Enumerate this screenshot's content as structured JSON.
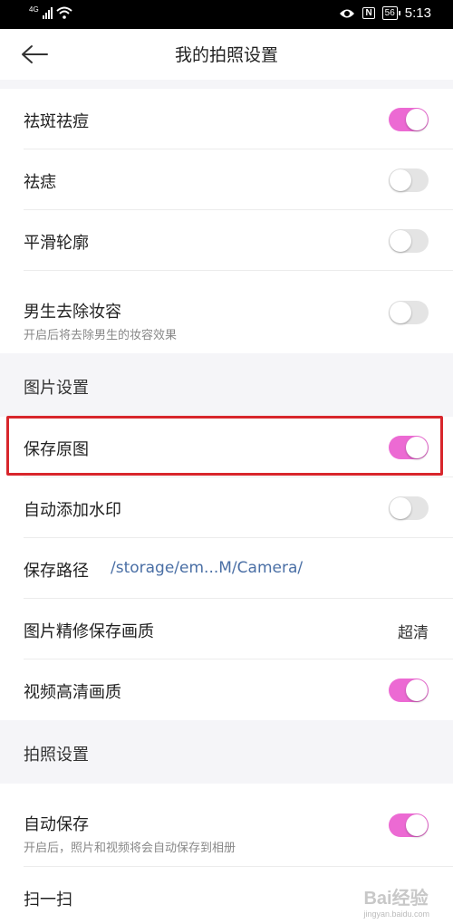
{
  "status_bar": {
    "network": "4G",
    "battery": "56",
    "time": "5:13",
    "nfc": "N"
  },
  "header": {
    "title": "我的拍照设置",
    "back_icon": "arrow-left-icon"
  },
  "beauty_rows": [
    {
      "label": "祛斑祛痘",
      "toggle_on": true
    },
    {
      "label": "祛痣",
      "toggle_on": false
    },
    {
      "label": "平滑轮廓",
      "toggle_on": false
    },
    {
      "label": "男生去除妆容",
      "sublabel": "开启后将去除男生的妆容效果",
      "toggle_on": false
    }
  ],
  "picture_section": {
    "title": "图片设置",
    "save_original": {
      "label": "保存原图",
      "toggle_on": true
    },
    "auto_watermark": {
      "label": "自动添加水印",
      "toggle_on": false
    },
    "save_path": {
      "label": "保存路径",
      "value": "/storage/em...M/Camera/"
    },
    "retouch_quality": {
      "label": "图片精修保存画质",
      "value": "超清"
    },
    "hd_video": {
      "label": "视频高清画质",
      "toggle_on": true
    }
  },
  "camera_section": {
    "title": "拍照设置",
    "auto_save": {
      "label": "自动保存",
      "sublabel": "开启后，照片和视频将会自动保存到相册",
      "toggle_on": true
    },
    "scan": {
      "label": "扫一扫"
    }
  },
  "colors": {
    "accent": "#ec6ad3",
    "toggle_off": "#e4e4e4",
    "highlight": "#d8262c",
    "path_link": "#4a6fa5"
  },
  "watermark": {
    "brand": "Bai经验",
    "url": "jingyan.baidu.com"
  }
}
